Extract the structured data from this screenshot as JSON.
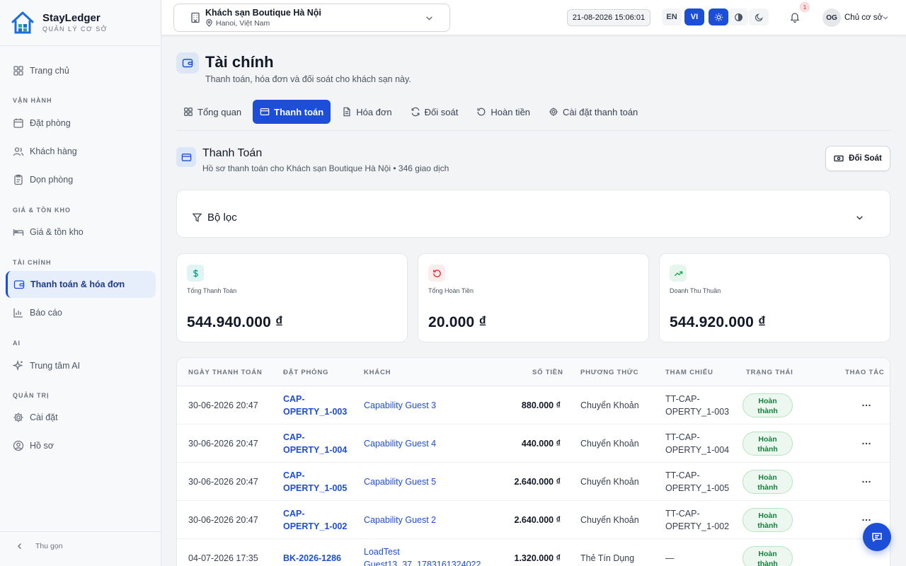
{
  "brand": {
    "name": "StayLedger",
    "subtitle": "QUẢN LÝ CƠ SỞ"
  },
  "sidebar": {
    "home": "Trang chủ",
    "sections": {
      "operations": "VẬN HÀNH",
      "pricing": "GIÁ & TỒN KHO",
      "finance": "TÀI CHÍNH",
      "ai": "AI",
      "admin": "QUẢN TRỊ"
    },
    "items": {
      "bookings": "Đặt phòng",
      "customers": "Khách hàng",
      "housekeeping": "Dọn phòng",
      "pricing": "Giá & tồn kho",
      "payments": "Thanh toán & hóa đơn",
      "reports": "Báo cáo",
      "ai_center": "Trung tâm AI",
      "settings": "Cài đặt",
      "profile": "Hồ sơ"
    },
    "collapse": "Thu gọn"
  },
  "topbar": {
    "hotel_name": "Khách sạn Boutique Hà Nội",
    "hotel_location": "Hanoi, Việt Nam",
    "datetime": "21-08-2026 15:06:01",
    "lang_en": "EN",
    "lang_vi": "VI",
    "notification_count": "1",
    "avatar_initials": "OG",
    "user_role": "Chủ cơ sở"
  },
  "page": {
    "title": "Tài chính",
    "subtitle": "Thanh toán, hóa đơn và đối soát cho khách sạn này."
  },
  "tabs": {
    "overview": "Tổng quan",
    "payments": "Thanh toán",
    "invoices": "Hóa đơn",
    "reconcile": "Đối soát",
    "refunds": "Hoàn tiền",
    "payment_settings": "Cài đặt thanh toán"
  },
  "section": {
    "title": "Thanh Toán",
    "subtitle": "Hồ sơ thanh toán cho Khách sạn Boutique Hà Nội • 346 giao dịch",
    "reconcile_button": "Đối Soát"
  },
  "filter": {
    "label": "Bộ lọc"
  },
  "stats": {
    "total_payments_label": "Tổng Thanh Toán",
    "total_payments_value": "544.940.000 ₫",
    "total_refunds_label": "Tổng Hoàn Tiền",
    "total_refunds_value": "20.000 ₫",
    "net_revenue_label": "Doanh Thu Thuần",
    "net_revenue_value": "544.920.000 ₫"
  },
  "table": {
    "headers": {
      "date": "NGÀY THANH TOÁN",
      "booking": "ĐẶT PHÒNG",
      "guest": "KHÁCH",
      "amount": "SỐ TIỀN",
      "method": "PHƯƠNG THỨC",
      "reference": "THAM CHIẾU",
      "status": "TRẠNG THÁI",
      "actions": "THAO TÁC"
    },
    "rows": [
      {
        "date": "30-06-2026 20:47",
        "booking_1": "CAP-",
        "booking_2": "OPERTY_1-003",
        "guest": "Capability Guest 3",
        "amount": "880.000 ₫",
        "method": "Chuyển Khoản",
        "ref_1": "TT-CAP-",
        "ref_2": "OPERTY_1-003",
        "status_1": "Hoàn",
        "status_2": "thành"
      },
      {
        "date": "30-06-2026 20:47",
        "booking_1": "CAP-",
        "booking_2": "OPERTY_1-004",
        "guest": "Capability Guest 4",
        "amount": "440.000 ₫",
        "method": "Chuyển Khoản",
        "ref_1": "TT-CAP-",
        "ref_2": "OPERTY_1-004",
        "status_1": "Hoàn",
        "status_2": "thành"
      },
      {
        "date": "30-06-2026 20:47",
        "booking_1": "CAP-",
        "booking_2": "OPERTY_1-005",
        "guest": "Capability Guest 5",
        "amount": "2.640.000 ₫",
        "method": "Chuyển Khoản",
        "ref_1": "TT-CAP-",
        "ref_2": "OPERTY_1-005",
        "status_1": "Hoàn",
        "status_2": "thành"
      },
      {
        "date": "30-06-2026 20:47",
        "booking_1": "CAP-",
        "booking_2": "OPERTY_1-002",
        "guest": "Capability Guest 2",
        "amount": "2.640.000 ₫",
        "method": "Chuyển Khoản",
        "ref_1": "TT-CAP-",
        "ref_2": "OPERTY_1-002",
        "status_1": "Hoàn",
        "status_2": "thành"
      },
      {
        "date": "04-07-2026 17:35",
        "booking_1": "BK-2026-1286",
        "booking_2": "",
        "guest_1": "LoadTest",
        "guest_2": "Guest13_37_1783161324022",
        "amount": "1.320.000 ₫",
        "method": "Thẻ Tín Dụng",
        "ref_1": "—",
        "ref_2": "",
        "status_1": "Hoàn",
        "status_2": "thành"
      }
    ]
  },
  "colors": {
    "primary": "#1d4ed8",
    "success": "#15803d",
    "danger": "#dc2626",
    "sidebar_bg": "#f8f9fb"
  }
}
